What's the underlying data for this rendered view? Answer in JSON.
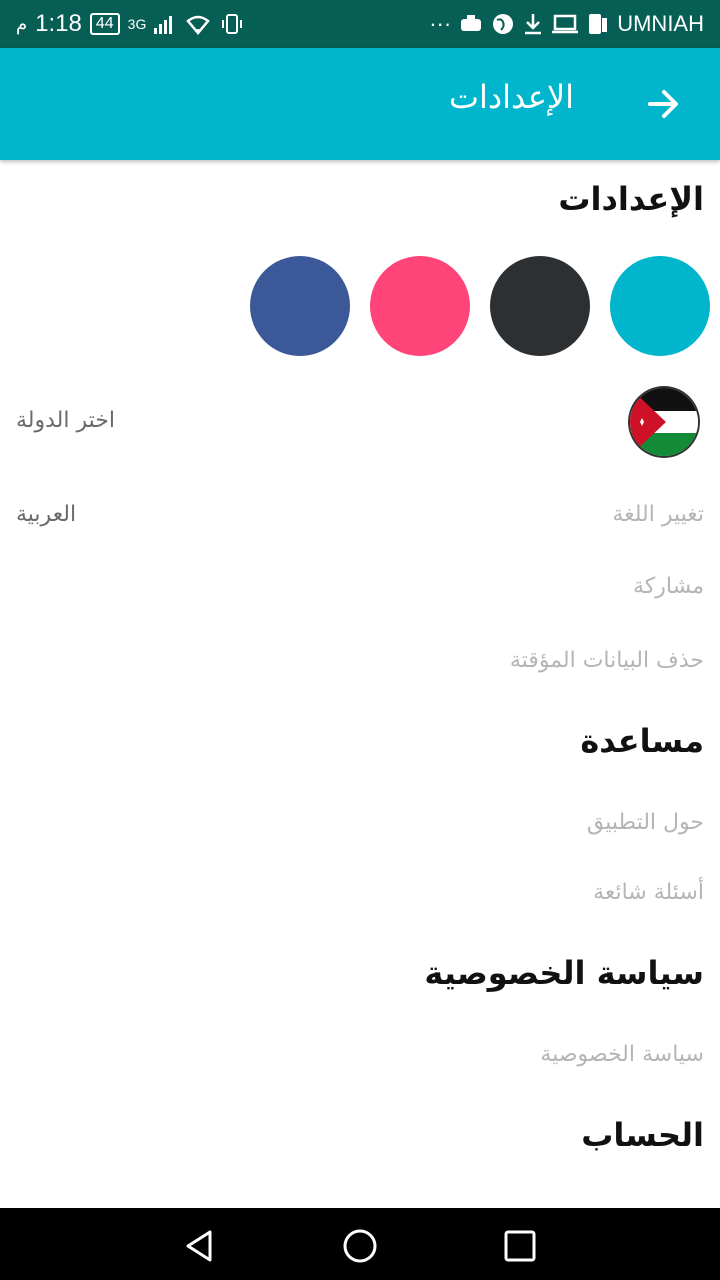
{
  "status": {
    "time": "1:18",
    "ampm": "م",
    "battery": "44",
    "network": "3G",
    "carrier": "UMNIAH",
    "dots": "···"
  },
  "appbar": {
    "title": "الإعدادات"
  },
  "sections": {
    "settings_title": "الإعدادات",
    "theme_colors": [
      "#00b5cc",
      "#2d3033",
      "#ff4479",
      "#3b5998"
    ],
    "choose_country": "اختر الدولة",
    "change_language": "تغيير اللغة",
    "language_value": "العربية",
    "share": "مشاركة",
    "clear_cache": "حذف البيانات المؤقتة",
    "help_title": "مساعدة",
    "about_app": "حول التطبيق",
    "faq": "أسئلة شائعة",
    "privacy_title": "سياسة الخصوصية",
    "privacy_item": "سياسة الخصوصية",
    "account_title": "الحساب"
  }
}
